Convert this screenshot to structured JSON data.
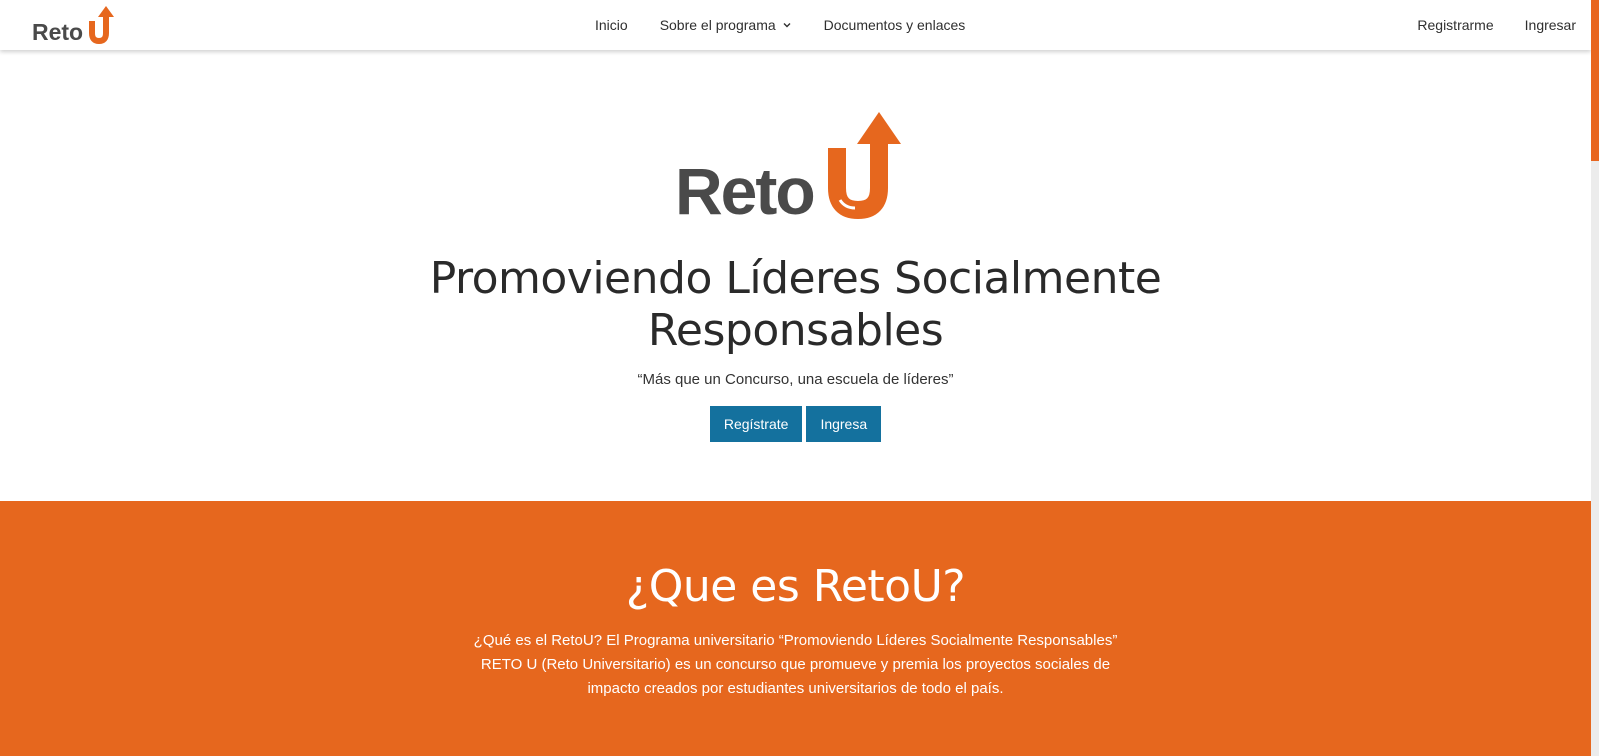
{
  "brand": {
    "logo_text": "Reto",
    "logo_letter": "U",
    "colors": {
      "orange": "#e6671e",
      "dark": "#4a4a4a",
      "button_blue": "#14719e"
    }
  },
  "nav": {
    "center_links": [
      {
        "label": "Inicio"
      },
      {
        "label": "Sobre el programa",
        "icon": "chevron-down-icon"
      },
      {
        "label": "Documentos y enlaces"
      }
    ],
    "right_links": [
      {
        "label": "Registrarme"
      },
      {
        "label": "Ingresar"
      }
    ]
  },
  "hero": {
    "title_line1": "Promoviendo Líderes Socialmente",
    "title_line2": "Responsables",
    "quote": "“Más que un Concurso, una escuela de líderes”",
    "buttons": {
      "register": "Regístrate",
      "login": "Ingresa"
    }
  },
  "about": {
    "title": "¿Que es RetoU?",
    "line1": "¿Qué es el RetoU? El Programa universitario “Promoviendo Líderes Socialmente Responsables”",
    "line2": "RETO U (Reto Universitario) es un concurso que promueve y premia los proyectos sociales de",
    "line3": "impacto creados por estudiantes universitarios de todo el país."
  }
}
